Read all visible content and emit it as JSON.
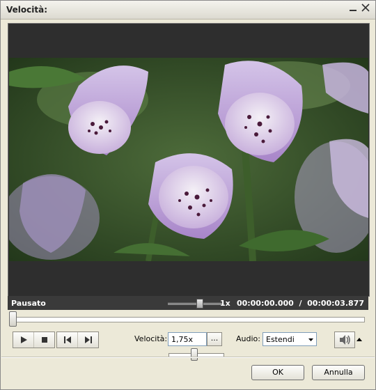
{
  "window": {
    "title": "Velocità:"
  },
  "player": {
    "status": "Pausato",
    "speed_indicator": "1x",
    "timecode": "00:00:00.000  /  00:00:03.877",
    "seek_position": 0.0,
    "volume_level": 0.55
  },
  "controls": {
    "speed_label": "Velocità:",
    "speed_value": "1,75x",
    "more_button": "...",
    "speed_slider_level": 0.44,
    "audio_label": "Audio:",
    "audio_value": "Estendi"
  },
  "buttons": {
    "ok": "OK",
    "cancel": "Annulla"
  }
}
